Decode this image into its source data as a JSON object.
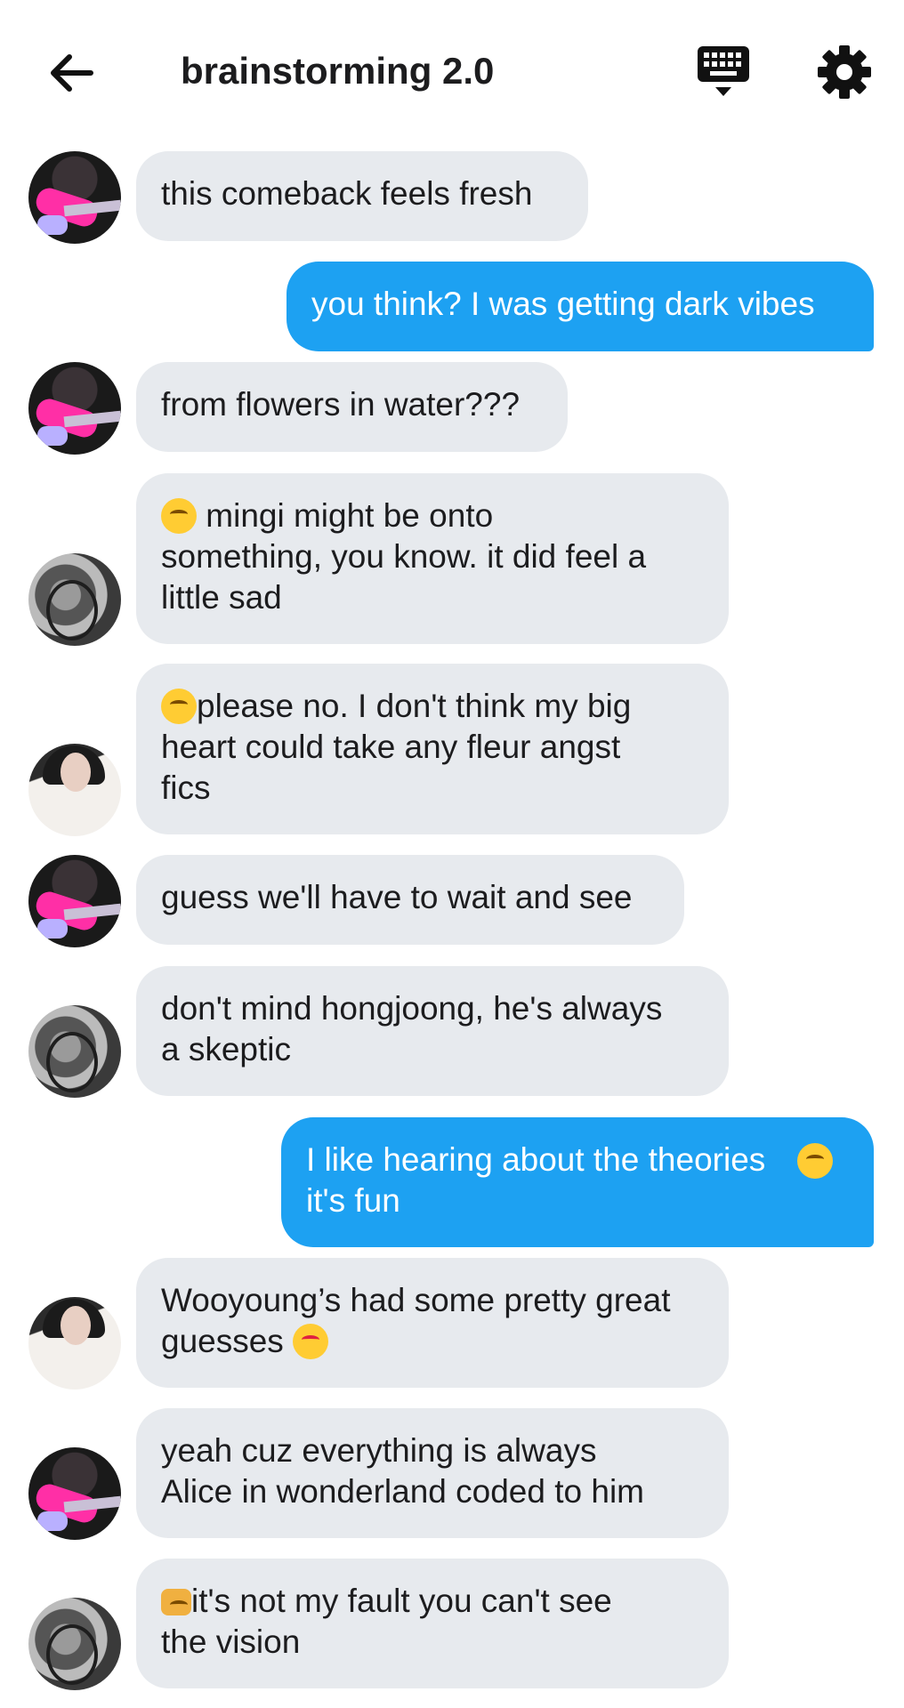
{
  "header": {
    "title": "brainstorming 2.0",
    "back_icon": "arrow-left-icon",
    "keyboard_icon": "keyboard-icon",
    "settings_icon": "gear-icon"
  },
  "colors": {
    "outgoing_bubble": "#1da1f2",
    "incoming_bubble": "#e7eaee",
    "text": "#1c1c1e"
  },
  "messages": [
    {
      "from": "guitar",
      "text": "this comeback feels fresh"
    },
    {
      "from": "me",
      "text": "you think? I was getting dark vibes"
    },
    {
      "from": "guitar",
      "text": "from flowers in water???"
    },
    {
      "from": "gray",
      "emoji": "thinking-face",
      "text": " mingi might be onto\nsomething, you know. it did feel a\nlittle sad"
    },
    {
      "from": "white",
      "emoji": "crying-face",
      "text": "please no. I don't think my big\nheart could take any fleur angst\nfics"
    },
    {
      "from": "guitar",
      "text": "guess we'll have to wait and see"
    },
    {
      "from": "gray",
      "text": "don't mind hongjoong, he's always\na skeptic"
    },
    {
      "from": "me",
      "text": "I like hearing about the theories \nit's fun",
      "emoji": "monocle-face"
    },
    {
      "from": "white",
      "text": "Wooyoung’s had some pretty great\nguesses ",
      "emoji": "star-struck-face"
    },
    {
      "from": "guitar",
      "text": "yeah cuz everything is always\nAlice in wonderland coded to him"
    },
    {
      "from": "gray",
      "emoji": "fist-bump",
      "text": "it's not my fault you can't see\nthe vision"
    }
  ]
}
